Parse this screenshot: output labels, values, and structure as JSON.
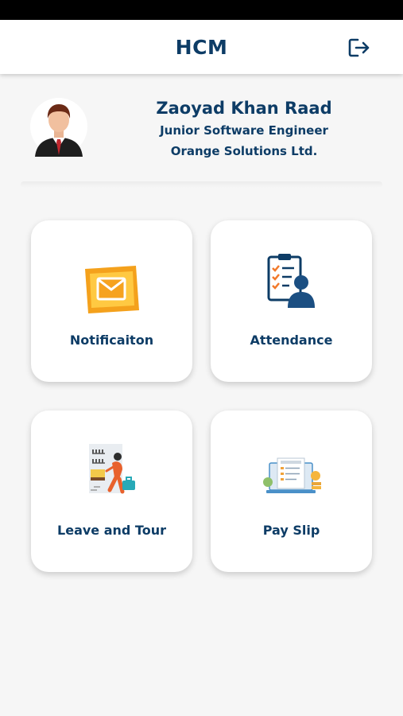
{
  "header": {
    "title": "HCM",
    "logout_icon": "logout-icon"
  },
  "profile": {
    "name": "Zaoyad Khan Raad",
    "designation": "Junior Software Engineer",
    "company": "Orange Solutions Ltd.",
    "avatar_icon": "businessman-avatar"
  },
  "tiles": [
    {
      "label": "Notificaiton",
      "icon": "envelope-icon"
    },
    {
      "label": "Attendance",
      "icon": "clipboard-person-icon"
    },
    {
      "label": "Leave and Tour",
      "icon": "traveler-icon"
    },
    {
      "label": "Pay Slip",
      "icon": "salary-slip-icon"
    }
  ],
  "colors": {
    "brand_text": "#0d3c66",
    "accent_orange": "#f5a623",
    "background": "#f6f6f6"
  }
}
